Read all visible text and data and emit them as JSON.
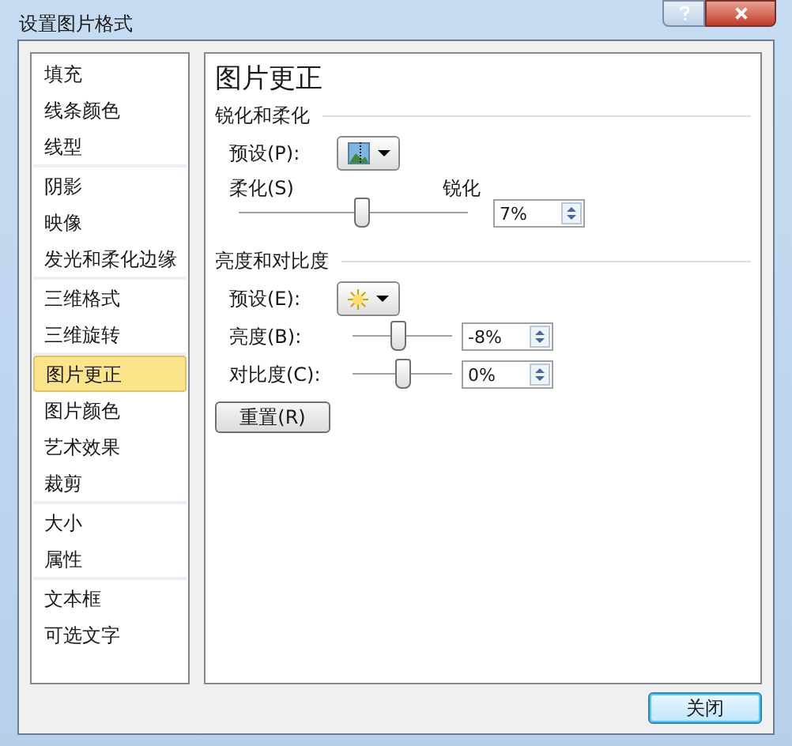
{
  "window": {
    "title": "设置图片格式"
  },
  "sidebar": {
    "groups": [
      {
        "items": [
          {
            "label": "填充",
            "selected": false
          },
          {
            "label": "线条颜色",
            "selected": false
          },
          {
            "label": "线型",
            "selected": false
          }
        ]
      },
      {
        "items": [
          {
            "label": "阴影",
            "selected": false
          },
          {
            "label": "映像",
            "selected": false
          },
          {
            "label": "发光和柔化边缘",
            "selected": false
          }
        ]
      },
      {
        "items": [
          {
            "label": "三维格式",
            "selected": false
          },
          {
            "label": "三维旋转",
            "selected": false
          }
        ]
      },
      {
        "items": [
          {
            "label": "图片更正",
            "selected": true
          },
          {
            "label": "图片颜色",
            "selected": false
          },
          {
            "label": "艺术效果",
            "selected": false
          },
          {
            "label": "裁剪",
            "selected": false
          }
        ]
      },
      {
        "items": [
          {
            "label": "大小",
            "selected": false
          },
          {
            "label": "属性",
            "selected": false
          }
        ]
      },
      {
        "items": [
          {
            "label": "文本框",
            "selected": false
          },
          {
            "label": "可选文字",
            "selected": false
          }
        ]
      }
    ]
  },
  "panel": {
    "title": "图片更正",
    "sharpen": {
      "heading": "锐化和柔化",
      "preset_label": "预设(P):",
      "soften_label": "柔化(S)",
      "sharpen_label": "锐化",
      "level": 0.54,
      "value": "7%"
    },
    "brightness": {
      "heading": "亮度和对比度",
      "preset_label": "预设(E):",
      "rows": [
        {
          "label": "亮度(B):",
          "level": 0.46,
          "value": "-8%"
        },
        {
          "label": "对比度(C):",
          "level": 0.5,
          "value": "0%"
        }
      ]
    },
    "reset_button": "重置(R)"
  },
  "close_button": "关闭"
}
